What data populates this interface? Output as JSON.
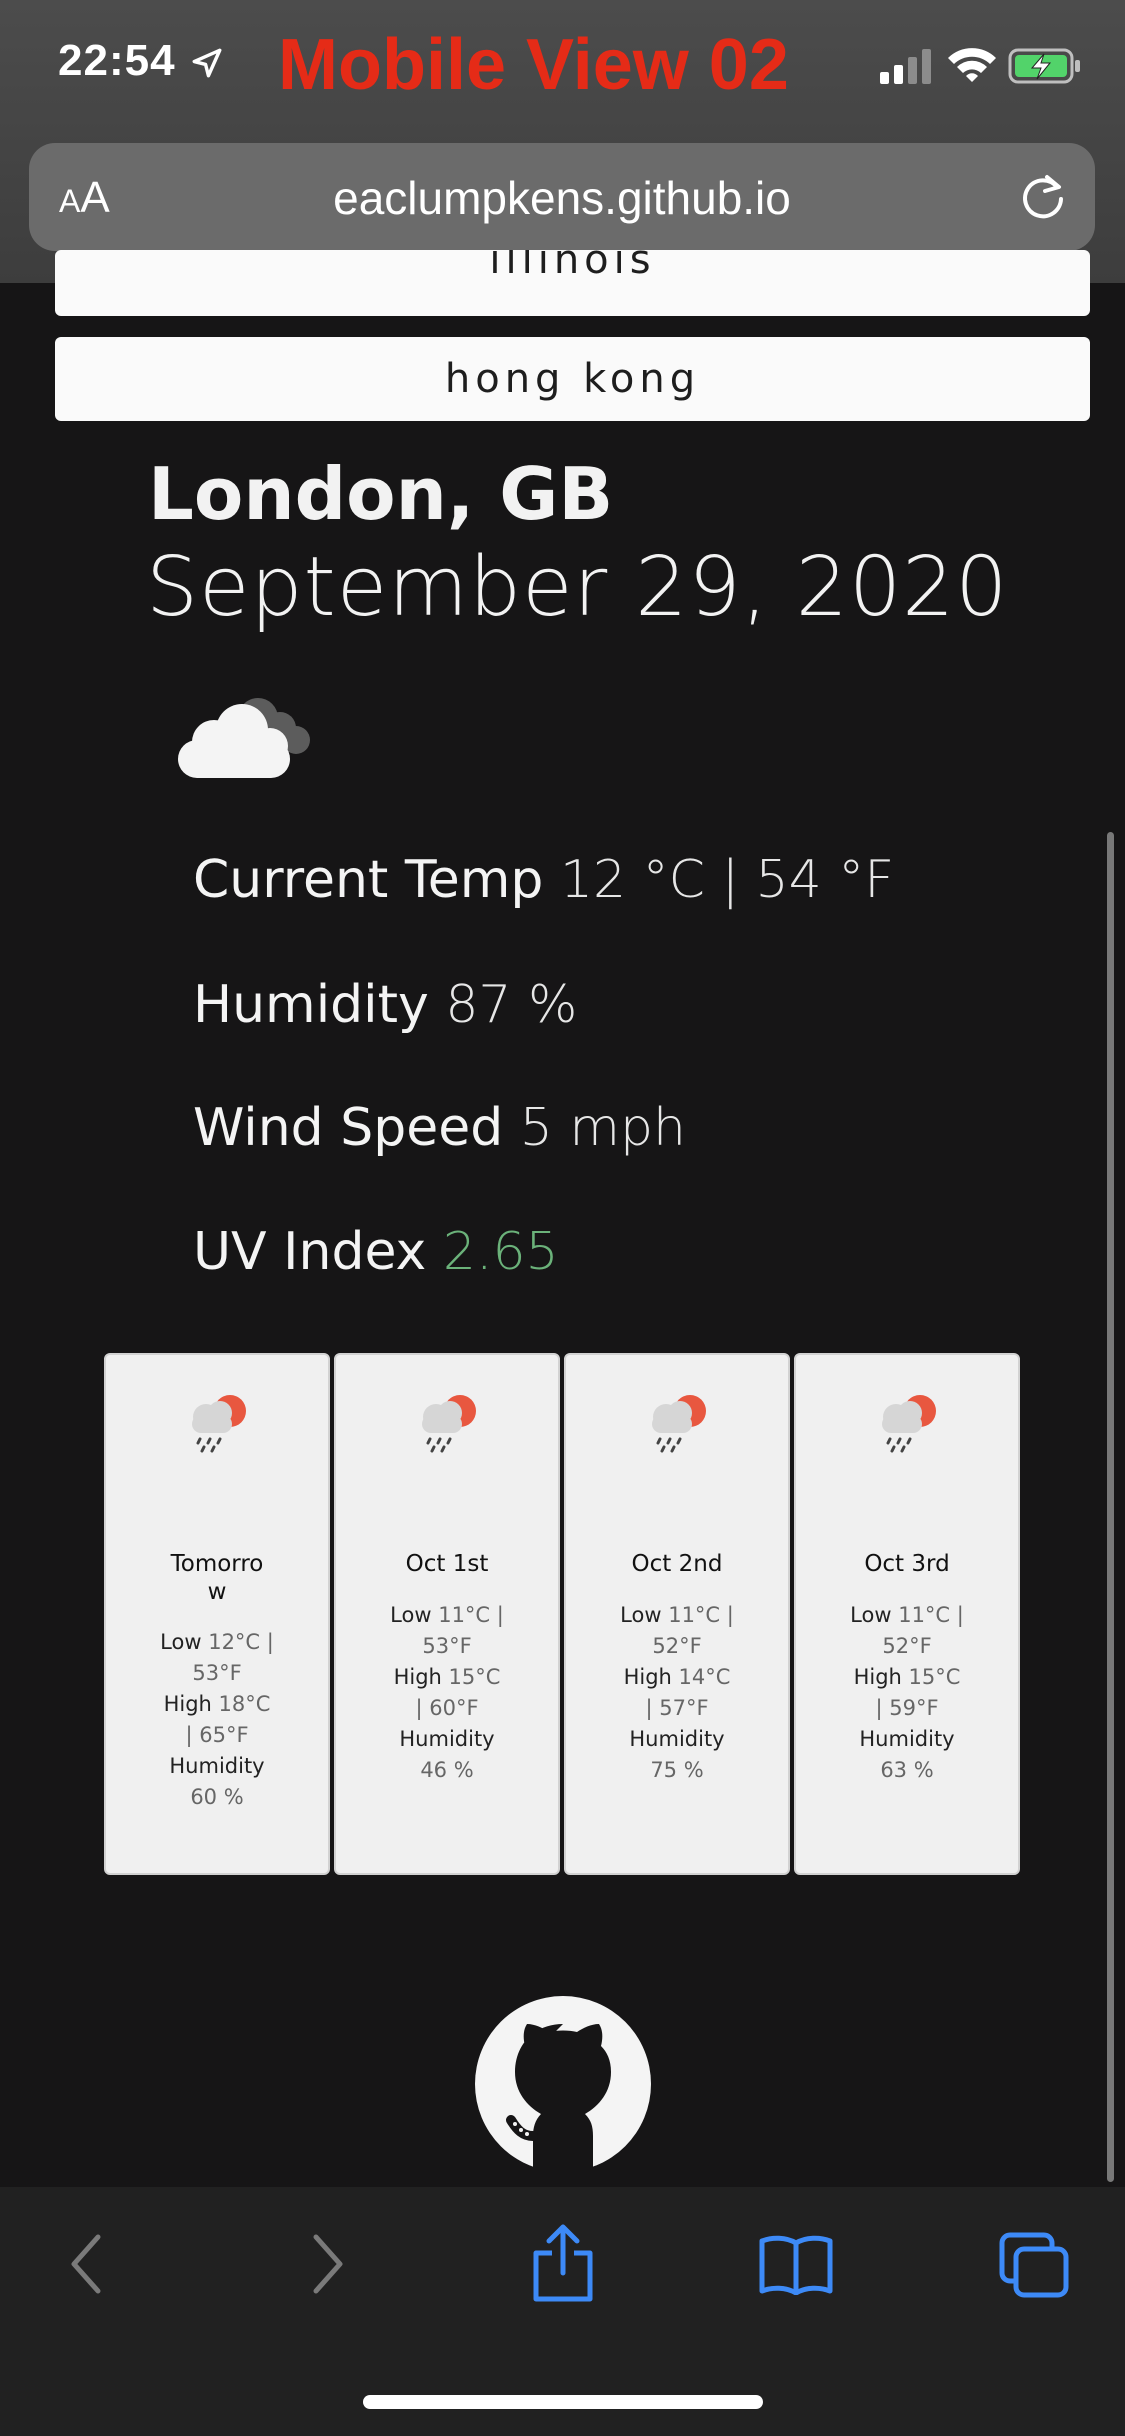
{
  "status_bar": {
    "time": "22:54",
    "overlay_title": "Mobile View 02"
  },
  "browser": {
    "aa_small": "A",
    "aa_big": "A",
    "url": "eaclumpkens.github.io"
  },
  "search_history": {
    "partial_item": "illinois",
    "item": "hong kong"
  },
  "current": {
    "city": "London, GB",
    "date": "September 29, 2020",
    "temp_label": "Current Temp",
    "temp_value": "12 °C | 54 °F",
    "humidity_label": "Humidity",
    "humidity_value": "87 %",
    "wind_label": "Wind Speed",
    "wind_value": "5 mph",
    "uv_label": "UV Index",
    "uv_value": "2.65",
    "uv_color": "#6bb27a",
    "icon": "cloudy-icon"
  },
  "forecast": [
    {
      "day": "Tomorro",
      "day2": "w",
      "low_label": "Low",
      "low": "12°C |",
      "low2": "53°F",
      "high_label": "High",
      "high": "18°C",
      "high2": "| 65°F",
      "hum_label": "Humidity",
      "hum": "60 %",
      "icon": "rain-sun-icon"
    },
    {
      "day": "Oct 1st",
      "low_label": "Low",
      "low": "11°C |",
      "low2": "53°F",
      "high_label": "High",
      "high": "15°C",
      "high2": "| 60°F",
      "hum_label": "Humidity",
      "hum": "46 %",
      "icon": "rain-sun-icon"
    },
    {
      "day": "Oct 2nd",
      "low_label": "Low",
      "low": "11°C |",
      "low2": "52°F",
      "high_label": "High",
      "high": "14°C",
      "high2": "| 57°F",
      "hum_label": "Humidity",
      "hum": "75 %",
      "icon": "rain-sun-icon"
    },
    {
      "day": "Oct 3rd",
      "low_label": "Low",
      "low": "11°C |",
      "low2": "52°F",
      "high_label": "High",
      "high": "15°C",
      "high2": "| 59°F",
      "hum_label": "Humidity",
      "hum": "63 %",
      "icon": "rain-sun-icon"
    }
  ],
  "colors": {
    "background": "#161516",
    "overlay_title": "#e52b17",
    "toolbar_accent": "#3d8af7"
  }
}
